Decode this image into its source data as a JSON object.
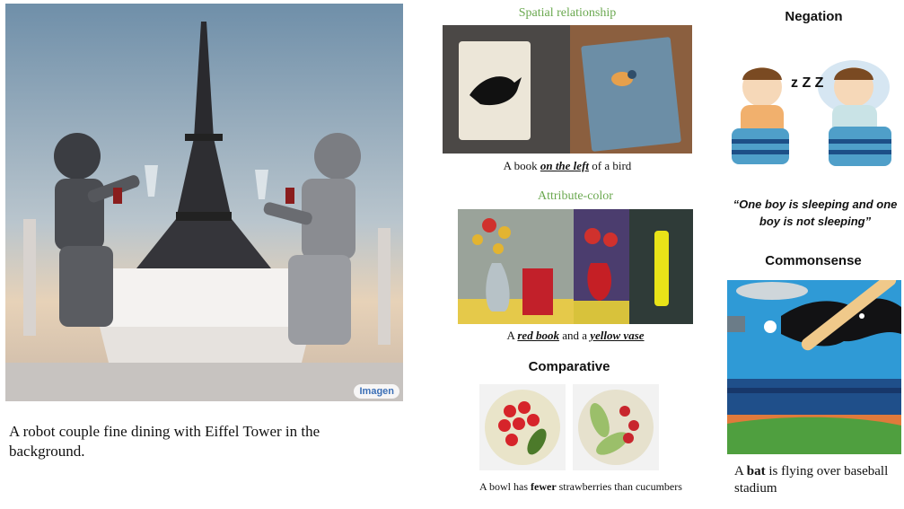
{
  "main_image": {
    "badge": "Imagen",
    "caption": "A robot couple fine dining with Eiffel Tower in the background."
  },
  "spatial": {
    "heading": "Spatial relationship",
    "caption_pre": "A book ",
    "caption_em": "on the left",
    "caption_post": " of a bird"
  },
  "attribute": {
    "heading": "Attribute-color",
    "caption_pre": "A ",
    "caption_em1": "red book",
    "caption_mid": " and a ",
    "caption_em2": "yellow vase"
  },
  "comparative": {
    "heading": "Comparative",
    "caption_pre": "A bowl has ",
    "caption_bold": "fewer",
    "caption_post": " strawberries than cucumbers"
  },
  "negation": {
    "heading": "Negation",
    "zzz": "z Z Z",
    "caption": "“One boy is sleeping and one boy is not sleeping”"
  },
  "commonsense": {
    "heading": "Commonsense",
    "caption_pre": "A ",
    "caption_bold": "bat",
    "caption_post": " is flying over baseball stadium"
  }
}
